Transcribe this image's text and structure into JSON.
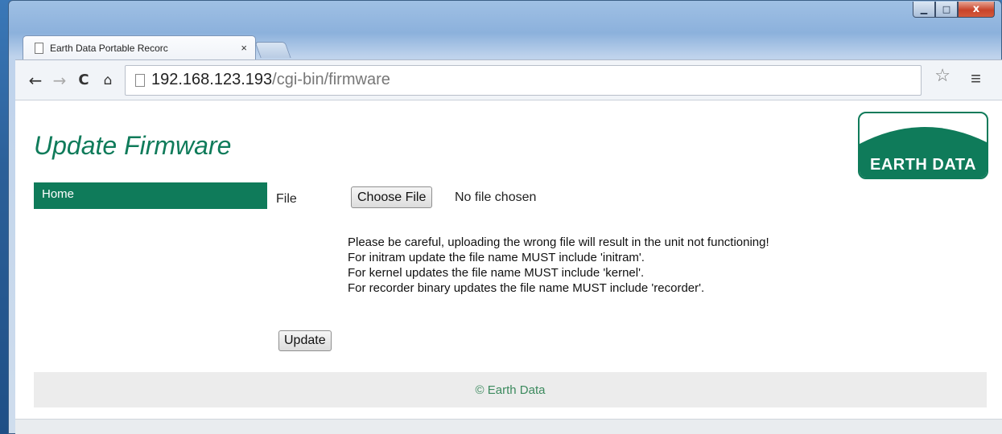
{
  "window": {
    "controls": {
      "minimize": "▁",
      "maximize": "□",
      "close": "x"
    }
  },
  "browser": {
    "tab_title": "Earth Data Portable Recorc",
    "tab_close": "×",
    "url_host": "192.168.123.193",
    "url_path": "/cgi-bin/firmware",
    "icons": [
      "back-arrow-icon",
      "forward-arrow-icon",
      "reload-icon",
      "home-icon",
      "star-icon",
      "menu-icon"
    ]
  },
  "page": {
    "title": "Update Firmware",
    "logo_text": "EARTH DATA",
    "nav": {
      "home": "Home"
    },
    "form": {
      "file_label": "File",
      "choose_button": "Choose File",
      "no_file": "No file chosen",
      "warnings": [
        "Please be careful, uploading the wrong file will result in the unit not functioning!",
        "For initram update the file name MUST include 'initram'.",
        "For kernel updates the file name MUST include 'kernel'.",
        "For recorder binary updates the file name MUST include 'recorder'."
      ],
      "update_button": "Update"
    },
    "footer": "© Earth Data",
    "colors": {
      "brand_green": "#0f7b5a",
      "footer_text": "#3c8a5e"
    }
  }
}
